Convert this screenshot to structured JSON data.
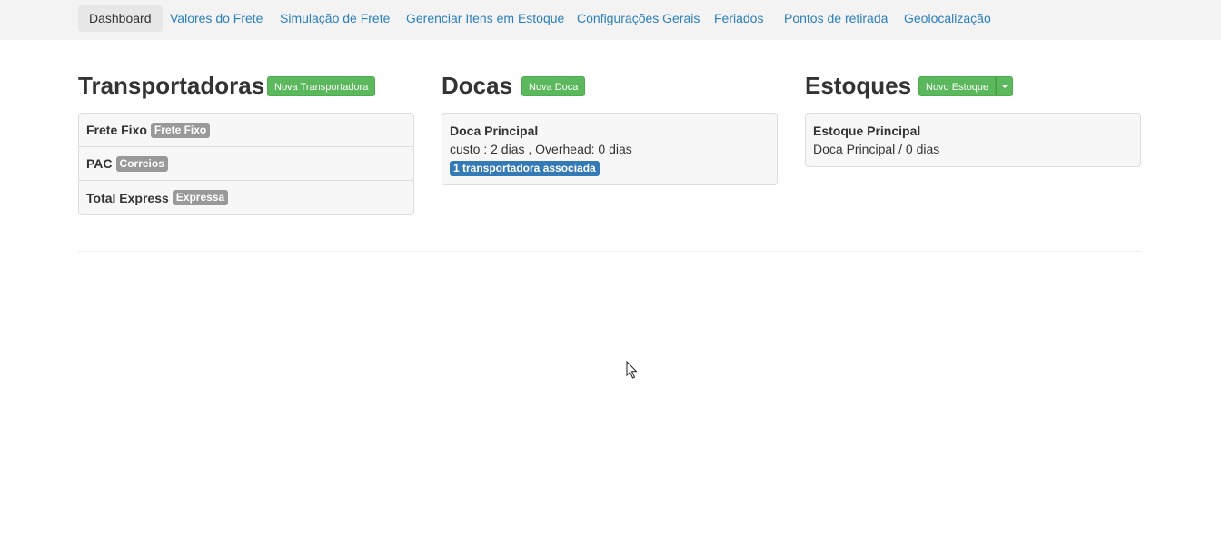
{
  "nav": {
    "items": [
      {
        "label": "Dashboard",
        "active": true
      },
      {
        "label": "Valores do Frete"
      },
      {
        "label": "Simulação de Frete"
      },
      {
        "label": "Gerenciar Itens em Estoque"
      },
      {
        "label": "Configurações Gerais"
      },
      {
        "label": "Feriados"
      },
      {
        "label": "Pontos de retirada"
      },
      {
        "label": "Geolocalização"
      }
    ]
  },
  "transportadoras": {
    "title": "Transportadoras",
    "new_button": "Nova Transportadora",
    "items": [
      {
        "name": "Frete Fixo",
        "badge": "Frete Fixo"
      },
      {
        "name": "PAC",
        "badge": "Correios"
      },
      {
        "name": "Total Express",
        "badge": "Expressa"
      }
    ]
  },
  "docas": {
    "title": "Docas",
    "new_button": "Nova Doca",
    "items": [
      {
        "name": "Doca Principal",
        "detail": "custo : 2 dias , Overhead: 0 dias",
        "badge": "1 transportadora associada"
      }
    ]
  },
  "estoques": {
    "title": "Estoques",
    "new_button": "Novo Estoque",
    "items": [
      {
        "name": "Estoque Principal",
        "detail": "Doca Principal / 0 dias"
      }
    ]
  },
  "colors": {
    "link": "#2a7fbf",
    "success": "#5cb85c",
    "primary_label": "#337ab7",
    "default_label": "#999999"
  }
}
